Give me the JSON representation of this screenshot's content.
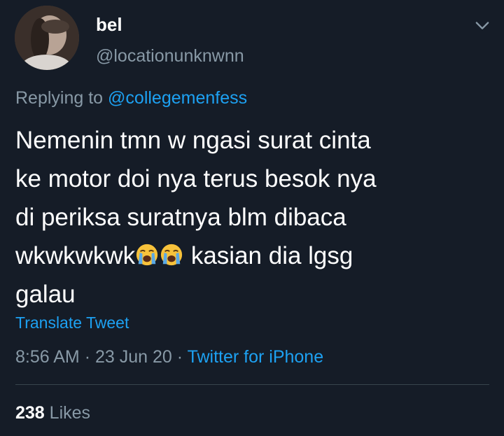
{
  "tweet": {
    "display_name": "bel",
    "handle": "@locationunknwnn",
    "replying_prefix": "Replying to",
    "replying_to": "@collegemenfess",
    "text_lines": [
      "Nemenin tmn w ngasi surat cinta",
      "ke motor doi nya terus besok nya",
      "di periksa suratnya blm dibaca"
    ],
    "line4_before_emoji": "wkwkwkwk",
    "line4_after_emoji": " kasian dia lgsg",
    "line5": "galau",
    "emoji_names": [
      "loudly-crying-face-icon",
      "loudly-crying-face-icon"
    ],
    "translate_label": "Translate Tweet",
    "time": "8:56 AM",
    "date": "23 Jun 20",
    "separator": "·",
    "source": "Twitter for iPhone",
    "likes_count": "238",
    "likes_label": "Likes"
  },
  "colors": {
    "background": "#151c27",
    "text_primary": "#ffffff",
    "text_secondary": "#8899a6",
    "link": "#1da1f2",
    "divider": "#38444d"
  }
}
